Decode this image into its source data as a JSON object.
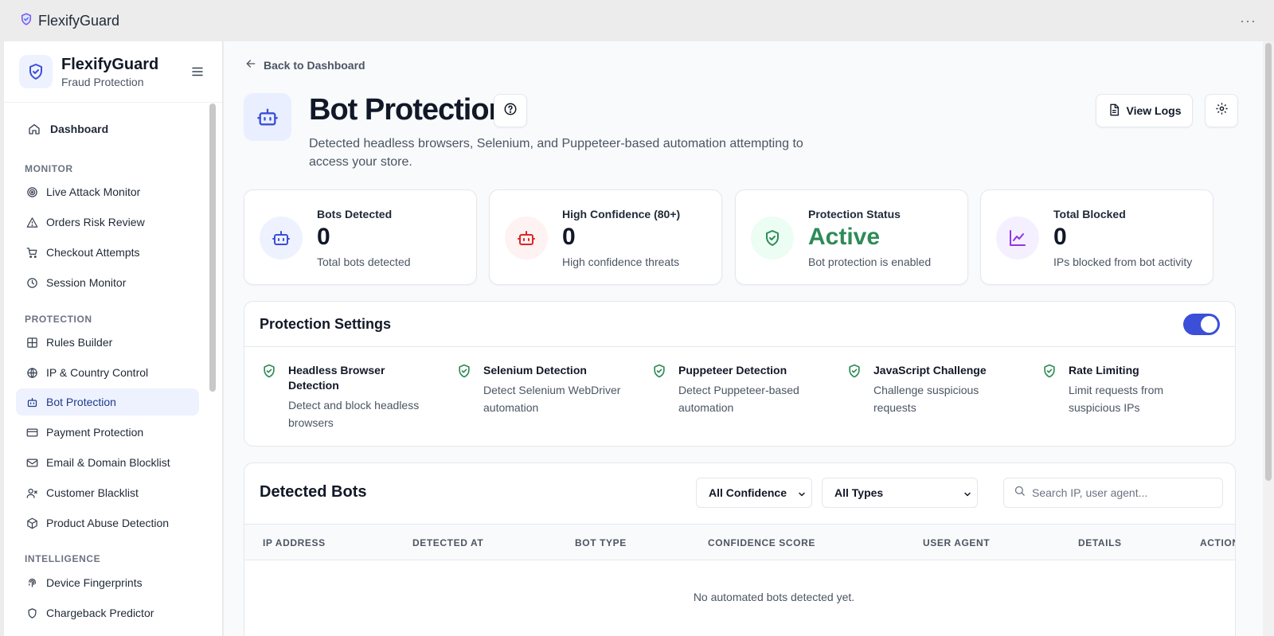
{
  "app": {
    "title": "FlexifyGuard",
    "more_label": "···"
  },
  "sidebar": {
    "title": "FlexifyGuard",
    "subtitle": "Fraud Protection",
    "dashboard": "Dashboard",
    "sections": {
      "monitor": "MONITOR",
      "protection": "PROTECTION",
      "intelligence": "INTELLIGENCE"
    },
    "monitor_items": [
      {
        "label": "Live Attack Monitor",
        "icon": "radar-icon"
      },
      {
        "label": "Orders Risk Review",
        "icon": "warning-icon"
      },
      {
        "label": "Checkout Attempts",
        "icon": "cart-icon"
      },
      {
        "label": "Session Monitor",
        "icon": "clock-icon"
      }
    ],
    "protection_items": [
      {
        "label": "Rules Builder",
        "icon": "grid-icon"
      },
      {
        "label": "IP & Country Control",
        "icon": "globe-icon"
      },
      {
        "label": "Bot Protection",
        "icon": "bot-icon",
        "active": true
      },
      {
        "label": "Payment Protection",
        "icon": "card-icon"
      },
      {
        "label": "Email & Domain Blocklist",
        "icon": "mail-icon"
      },
      {
        "label": "Customer Blacklist",
        "icon": "user-x-icon"
      },
      {
        "label": "Product Abuse Detection",
        "icon": "package-icon"
      }
    ],
    "intelligence_items": [
      {
        "label": "Device Fingerprints",
        "icon": "fingerprint-icon"
      },
      {
        "label": "Chargeback Predictor",
        "icon": "shield-icon"
      }
    ]
  },
  "page": {
    "back_label": "Back to Dashboard",
    "title": "Bot Protection",
    "description": "Detected headless browsers, Selenium, and Puppeteer-based automation attempting to access your store.",
    "view_logs_label": "View Logs"
  },
  "stats": [
    {
      "label": "Bots Detected",
      "value": "0",
      "desc": "Total bots detected",
      "color": "#3b4fd8",
      "bg": "#eef2ff"
    },
    {
      "label": "High Confidence (80+)",
      "value": "0",
      "desc": "High confidence threats",
      "color": "#dc2626",
      "bg": "#fef2f2"
    },
    {
      "label": "Protection Status",
      "value": "Active",
      "desc": "Bot protection is enabled",
      "color": "#2e8b57",
      "bg": "#ecfdf3"
    },
    {
      "label": "Total Blocked",
      "value": "0",
      "desc": "IPs blocked from bot activity",
      "color": "#9333ea",
      "bg": "#f5f0ff"
    }
  ],
  "settings": {
    "title": "Protection Settings",
    "enabled": true,
    "features": [
      {
        "title": "Headless Browser Detection",
        "desc": "Detect and block headless browsers"
      },
      {
        "title": "Selenium Detection",
        "desc": "Detect Selenium WebDriver automation"
      },
      {
        "title": "Puppeteer Detection",
        "desc": "Detect Puppeteer-based automation"
      },
      {
        "title": "JavaScript Challenge",
        "desc": "Challenge suspicious requests"
      },
      {
        "title": "Rate Limiting",
        "desc": "Limit requests from suspicious IPs"
      }
    ]
  },
  "bots": {
    "title": "Detected Bots",
    "confidence_filter": "All Confidence",
    "type_filter": "All Types",
    "search_placeholder": "Search IP, user agent...",
    "columns": [
      "IP ADDRESS",
      "DETECTED AT",
      "BOT TYPE",
      "CONFIDENCE SCORE",
      "USER AGENT",
      "DETAILS",
      "ACTIONS"
    ],
    "empty_message": "No automated bots detected yet."
  },
  "colors": {
    "accent": "#3b4fd8",
    "success": "#2e8b57"
  }
}
